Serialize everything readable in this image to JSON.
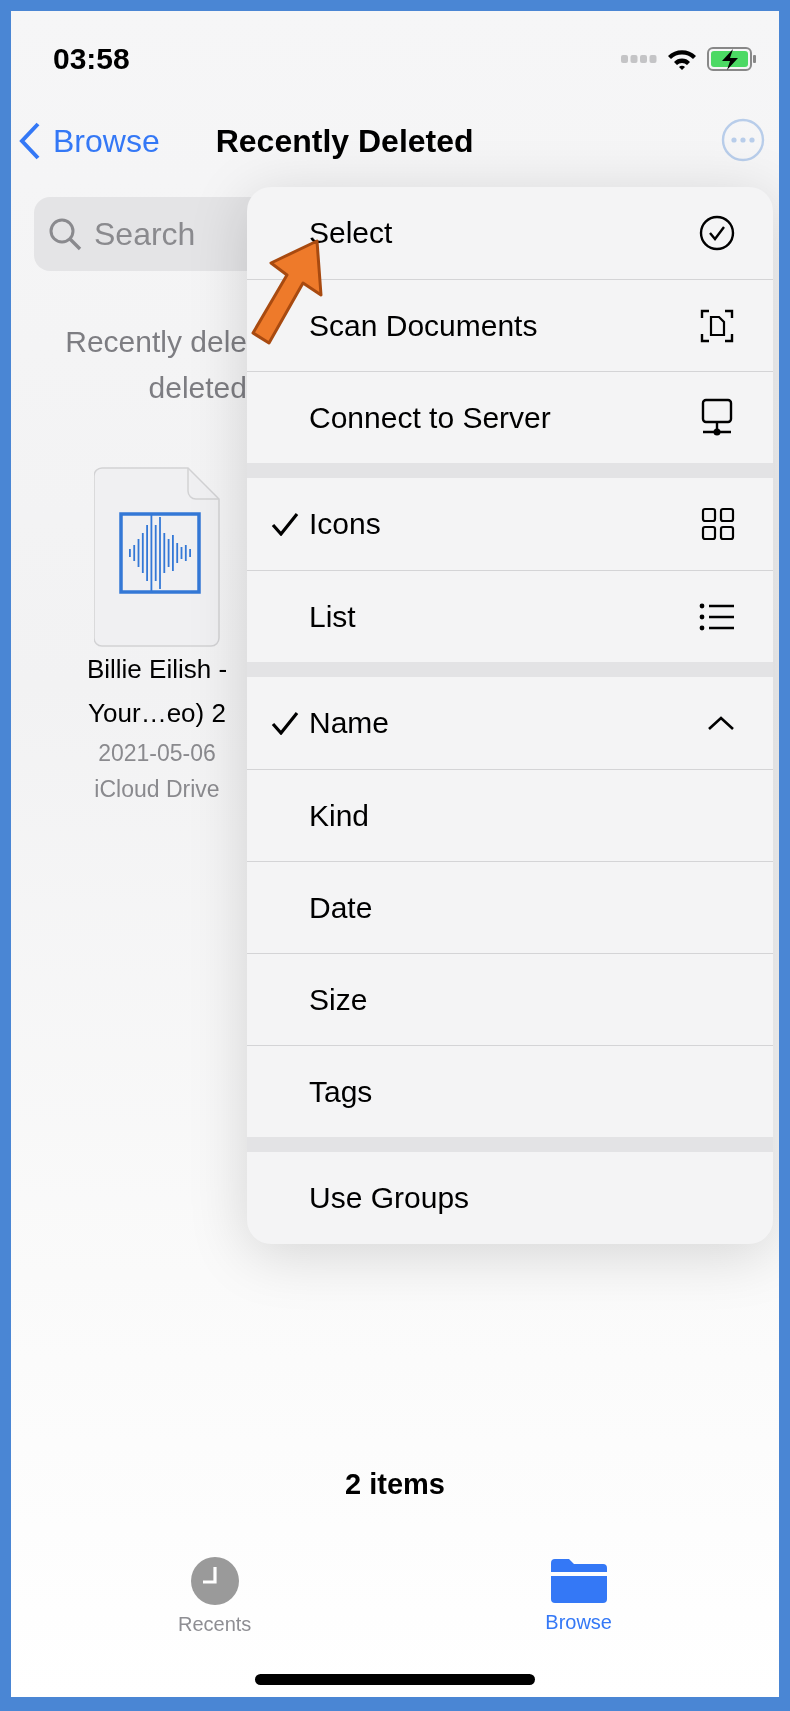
{
  "status_bar": {
    "time": "03:58"
  },
  "nav": {
    "back": "Browse",
    "title": "Recently Deleted"
  },
  "search": {
    "placeholder": "Search"
  },
  "notice": [
    "Recently dele",
    "deleted"
  ],
  "files": [
    {
      "name": [
        "Billie Eilish -",
        "Your…eo) 2"
      ],
      "date": "2021-05-06",
      "location": "iCloud Drive"
    }
  ],
  "menu": {
    "sections": [
      [
        {
          "label": "Select",
          "kind": "select",
          "checked": false
        },
        {
          "label": "Scan Documents",
          "kind": "scan",
          "checked": false
        },
        {
          "label": "Connect to Server",
          "kind": "server",
          "checked": false
        }
      ],
      [
        {
          "label": "Icons",
          "kind": "grid",
          "checked": true
        },
        {
          "label": "List",
          "kind": "list",
          "checked": false
        }
      ],
      [
        {
          "label": "Name",
          "kind": "sort",
          "checked": true
        },
        {
          "label": "Kind",
          "kind": "plain",
          "checked": false
        },
        {
          "label": "Date",
          "kind": "plain",
          "checked": false
        },
        {
          "label": "Size",
          "kind": "plain",
          "checked": false
        },
        {
          "label": "Tags",
          "kind": "plain",
          "checked": false
        }
      ],
      [
        {
          "label": "Use Groups",
          "kind": "plain",
          "checked": false
        }
      ]
    ]
  },
  "footer": {
    "count": "2 items"
  },
  "tabs": [
    {
      "label": "Recents",
      "kind": "recents",
      "selected": false
    },
    {
      "label": "Browse",
      "kind": "browse",
      "selected": true
    }
  ]
}
